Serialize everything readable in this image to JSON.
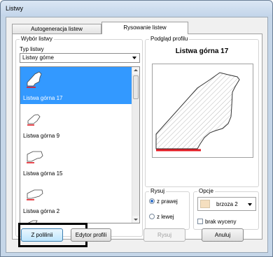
{
  "window": {
    "title": "Listwy"
  },
  "tabs": [
    {
      "label": "Autogeneracja listew"
    },
    {
      "label": "Rysowanie listew"
    }
  ],
  "selection_group": {
    "legend": "Wybór listwy",
    "type_label": "Typ listwy",
    "type_value": "Listwy górne",
    "items": [
      {
        "label": "Listwa górna 17",
        "selected": true
      },
      {
        "label": "Listwa górna 9",
        "selected": false
      },
      {
        "label": "Listwa górna 15",
        "selected": false
      },
      {
        "label": "Listwa górna 2",
        "selected": false
      }
    ]
  },
  "preview_group": {
    "legend": "Podgląd profilu",
    "title": "Listwa górna 17"
  },
  "draw_group": {
    "legend": "Rysuj",
    "options": [
      {
        "label": "z prawej",
        "checked": true
      },
      {
        "label": "z lewej",
        "checked": false
      }
    ]
  },
  "options_group": {
    "legend": "Opcje",
    "material": "brzoza 2",
    "material_color": "#f5dfbf",
    "no_pricing_label": "brak wyceny",
    "no_pricing_checked": false
  },
  "buttons": {
    "z_polilinii": "Z polilinii",
    "edytor_profili": "Edytor profili",
    "rysuj": "Rysuj",
    "anuluj": "Anuluj"
  },
  "colors": {
    "selection": "#3399ff",
    "profile_base": "#e31b23"
  }
}
